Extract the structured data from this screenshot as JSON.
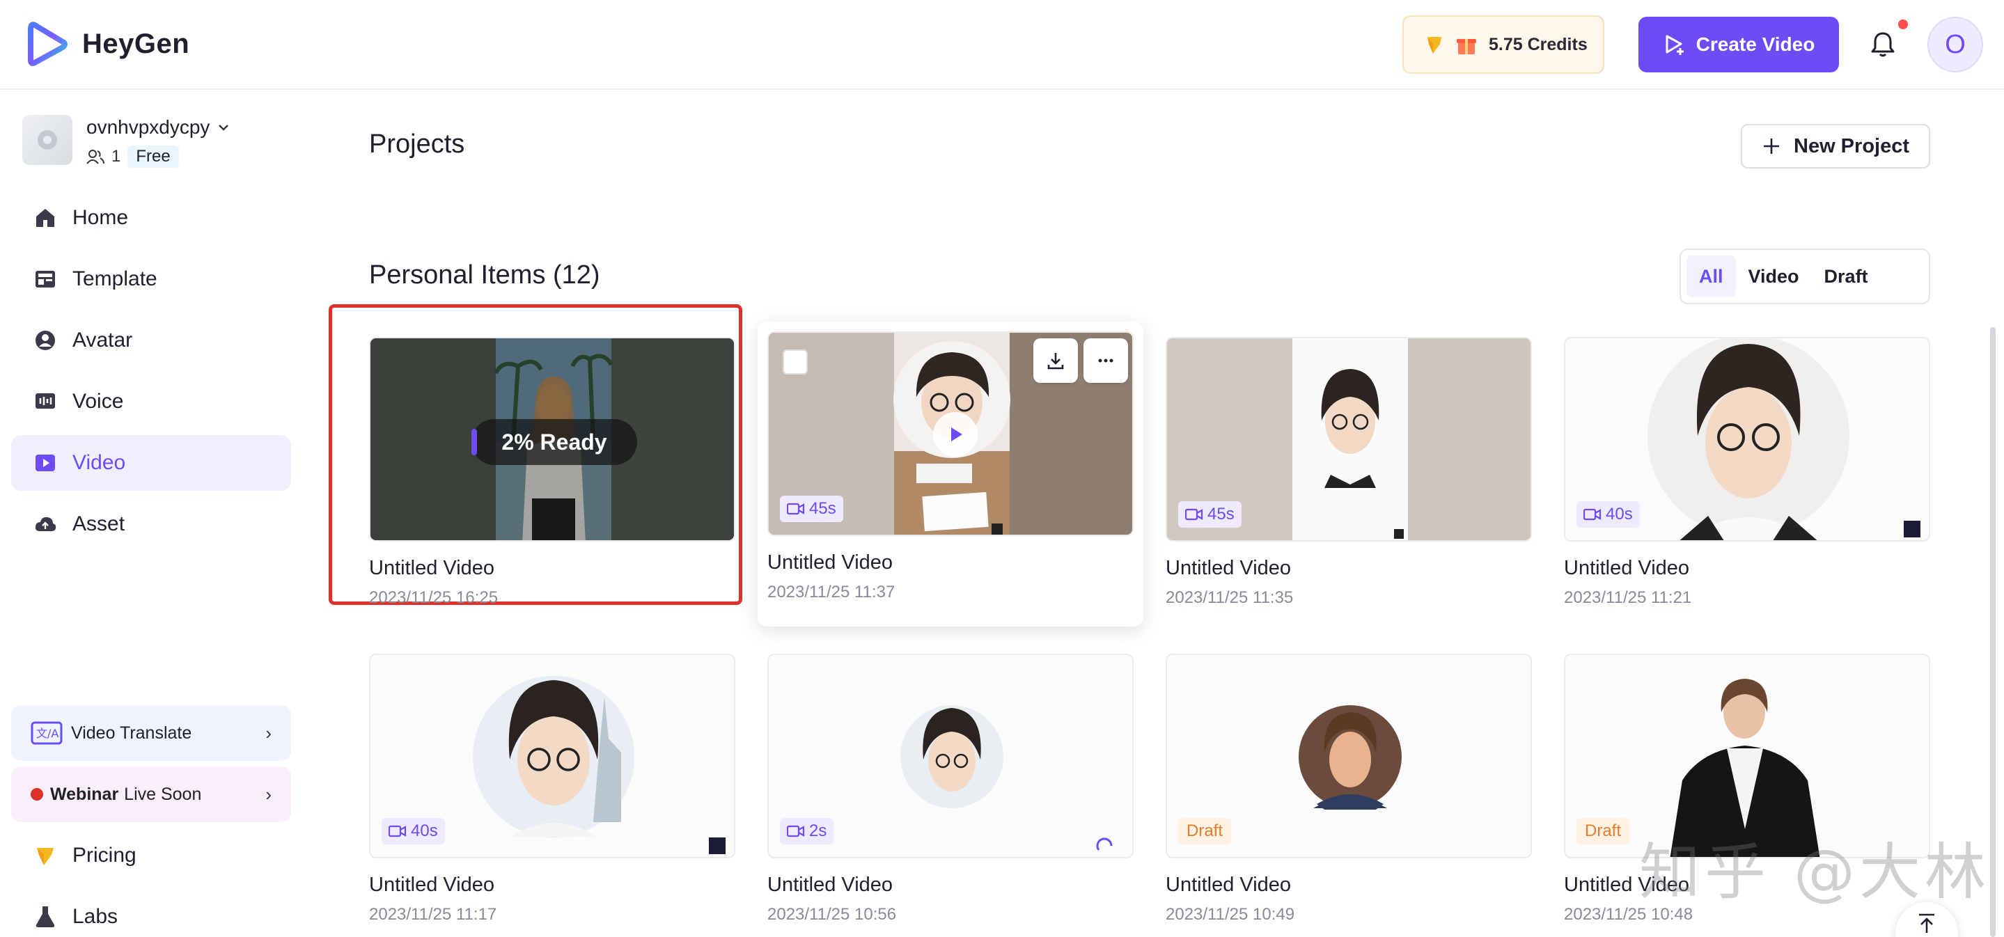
{
  "app": {
    "brand": "HeyGen"
  },
  "header": {
    "credits": "5.75 Credits",
    "create_label": "Create Video",
    "user_initial": "O"
  },
  "sidebar": {
    "workspace": {
      "name": "ovnhvpxdycpy",
      "members": "1",
      "plan": "Free"
    },
    "items": [
      {
        "label": "Home",
        "icon": "home-icon"
      },
      {
        "label": "Template",
        "icon": "template-icon"
      },
      {
        "label": "Avatar",
        "icon": "avatar-icon"
      },
      {
        "label": "Voice",
        "icon": "voice-icon"
      },
      {
        "label": "Video",
        "icon": "video-icon",
        "active": true
      },
      {
        "label": "Asset",
        "icon": "cloud-upload-icon"
      }
    ],
    "promos": [
      {
        "label": "Video Translate",
        "icon": "translate-icon"
      },
      {
        "strong": "Webinar",
        "label": "Live Soon"
      }
    ],
    "bottom": [
      {
        "label": "Pricing",
        "icon": "gem-icon"
      },
      {
        "label": "Labs",
        "icon": "flask-icon"
      }
    ]
  },
  "main": {
    "title": "Projects",
    "new_project": "New Project",
    "section_title": "Personal Items (12)",
    "filters": [
      "All",
      "Video",
      "Draft"
    ],
    "cards": [
      {
        "title": "Untitled Video",
        "date": "2023/11/25 16:25",
        "status": "2% Ready"
      },
      {
        "title": "Untitled Video",
        "date": "2023/11/25 11:37",
        "duration": "45s"
      },
      {
        "title": "Untitled Video",
        "date": "2023/11/25 11:35",
        "duration": "45s"
      },
      {
        "title": "Untitled Video",
        "date": "2023/11/25 11:21",
        "duration": "40s"
      },
      {
        "title": "Untitled Video",
        "date": "2023/11/25 11:17",
        "duration": "40s"
      },
      {
        "title": "Untitled Video",
        "date": "2023/11/25 10:56",
        "duration": "2s"
      },
      {
        "title": "Untitled Video",
        "date": "2023/11/25 10:49",
        "badge": "Draft"
      },
      {
        "title": "Untitled Video",
        "date": "2023/11/25 10:48",
        "badge": "Draft"
      }
    ]
  },
  "watermark": "知乎 @大林",
  "colors": {
    "accent": "#6b4cf5",
    "draft": "#e67c2a",
    "highlight": "#e0302a"
  }
}
